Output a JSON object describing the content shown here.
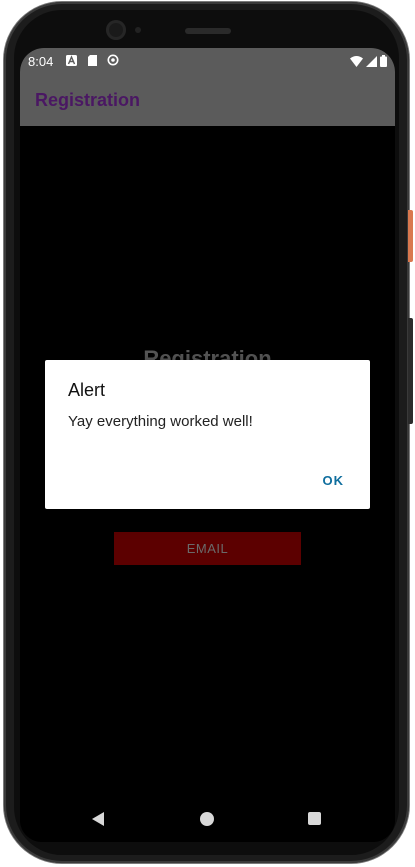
{
  "status_bar": {
    "time": "8:04",
    "left_icons": [
      "a-badge-icon",
      "sd-card-icon",
      "sync-circle-icon"
    ],
    "right_icons": [
      "wifi-icon",
      "cell-signal-icon",
      "battery-icon"
    ]
  },
  "app_bar": {
    "title": "Registration",
    "title_color": "#4a1763",
    "background": "#5b5b5b"
  },
  "screen": {
    "background_title": "Registration",
    "email_button_label": "EMAIL",
    "email_button_color": "#5c0000"
  },
  "dialog": {
    "title": "Alert",
    "message": "Yay everything worked well!",
    "ok_label": "OK",
    "ok_color": "#0f6e9e"
  },
  "nav_bar": {
    "icons": [
      "back-icon",
      "home-icon",
      "recents-icon"
    ]
  }
}
